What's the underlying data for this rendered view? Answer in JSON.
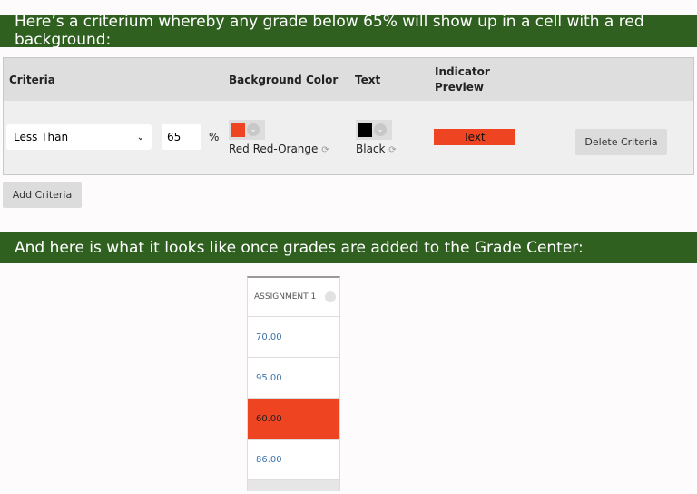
{
  "banner_top": "Here’s a criterium whereby any grade below 65% will show up in a cell with a red background:",
  "banner_bottom": "And here is what it looks like once grades are added to the Grade Center:",
  "table": {
    "headers": {
      "criteria": "Criteria",
      "bg_color": "Background Color",
      "text": "Text",
      "preview": "Indicator Preview"
    },
    "row": {
      "operator": "Less Than",
      "value": "65",
      "unit": "%",
      "bg_color_name": "Red Red-Orange",
      "bg_color": "#ee4422",
      "text_color_name": "Black",
      "text_color": "#000000",
      "preview_text": "Text",
      "delete_label": "Delete Criteria"
    }
  },
  "add_criteria_label": "Add Criteria",
  "grade_column": {
    "header": "ASSIGNMENT 1",
    "grades": [
      {
        "value": "70.00",
        "highlight": false
      },
      {
        "value": "95.00",
        "highlight": false
      },
      {
        "value": "60.00",
        "highlight": true
      },
      {
        "value": "86.00",
        "highlight": false
      }
    ]
  }
}
